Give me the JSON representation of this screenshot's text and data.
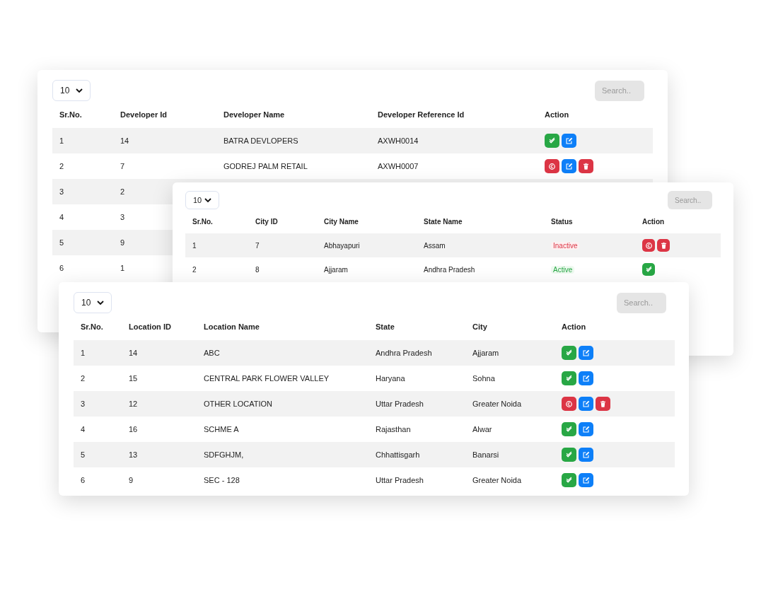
{
  "panels": [
    {
      "page_size": "10",
      "search_placeholder": "Search..",
      "columns": [
        "Sr.No.",
        "Developer Id",
        "Developer Name",
        "Developer Reference Id",
        "Action"
      ],
      "rows": [
        {
          "cells": [
            "1",
            "14",
            "BATRA DEVLOPERS",
            "AXWH0014"
          ],
          "actions": [
            {
              "kind": "approve"
            },
            {
              "kind": "edit"
            }
          ]
        },
        {
          "cells": [
            "2",
            "7",
            "GODREJ PALM RETAIL",
            "AXWH0007"
          ],
          "actions": [
            {
              "kind": "block"
            },
            {
              "kind": "edit"
            },
            {
              "kind": "delete"
            }
          ]
        },
        {
          "cells": [
            "3",
            "2"
          ]
        },
        {
          "cells": [
            "4",
            "3"
          ]
        },
        {
          "cells": [
            "5",
            "9"
          ]
        },
        {
          "cells": [
            "6",
            "1"
          ]
        }
      ]
    },
    {
      "page_size": "10",
      "search_placeholder": "Search..",
      "columns": [
        "Sr.No.",
        "City ID",
        "City Name",
        "State Name",
        "Status",
        "Action"
      ],
      "rows": [
        {
          "cells": [
            "1",
            "7",
            "Abhayapuri",
            "Assam"
          ],
          "status": {
            "label": "Inactive",
            "active": false
          },
          "actions": [
            {
              "kind": "block"
            },
            {
              "kind": "delete"
            }
          ]
        },
        {
          "cells": [
            "2",
            "8",
            "Ajjaram",
            "Andhra Pradesh"
          ],
          "status": {
            "label": "Active",
            "active": true
          },
          "actions": [
            {
              "kind": "approve"
            }
          ]
        }
      ]
    },
    {
      "page_size": "10",
      "search_placeholder": "Search..",
      "columns": [
        "Sr.No.",
        "Location ID",
        "Location Name",
        "State",
        "City",
        "Action"
      ],
      "rows": [
        {
          "cells": [
            "1",
            "14",
            "ABC",
            "Andhra Pradesh",
            "Ajjaram"
          ],
          "actions": [
            {
              "kind": "approve"
            },
            {
              "kind": "edit"
            }
          ]
        },
        {
          "cells": [
            "2",
            "15",
            "CENTRAL PARK FLOWER VALLEY",
            "Haryana",
            "Sohna"
          ],
          "actions": [
            {
              "kind": "approve"
            },
            {
              "kind": "edit"
            }
          ]
        },
        {
          "cells": [
            "3",
            "12",
            "OTHER LOCATION",
            "Uttar Pradesh",
            "Greater Noida"
          ],
          "actions": [
            {
              "kind": "block"
            },
            {
              "kind": "edit"
            },
            {
              "kind": "delete"
            }
          ]
        },
        {
          "cells": [
            "4",
            "16",
            "SCHME A",
            "Rajasthan",
            "Alwar"
          ],
          "actions": [
            {
              "kind": "approve"
            },
            {
              "kind": "edit"
            }
          ]
        },
        {
          "cells": [
            "5",
            "13",
            "SDFGHJM,",
            "Chhattisgarh",
            "Banarsi"
          ],
          "actions": [
            {
              "kind": "approve"
            },
            {
              "kind": "edit"
            }
          ]
        },
        {
          "cells": [
            "6",
            "9",
            "SEC - 128",
            "Uttar Pradesh",
            "Greater Noida"
          ],
          "actions": [
            {
              "kind": "approve"
            },
            {
              "kind": "edit"
            }
          ]
        }
      ]
    }
  ]
}
